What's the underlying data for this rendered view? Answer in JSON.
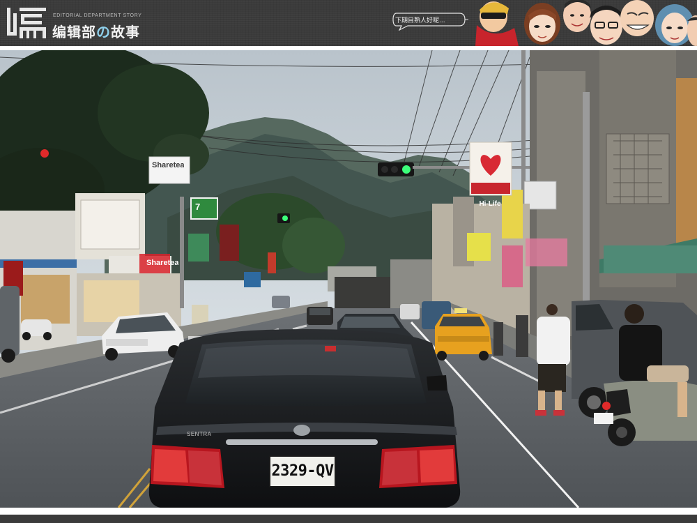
{
  "header": {
    "subtitle": "EDITORIAL DEPARTMENT STORY",
    "title_before": "编辑部",
    "title_accent": "の",
    "title_after": "故事",
    "bubble_text": "下期目熟人好呢..."
  },
  "photo": {
    "license_plate": "2329-QV",
    "car_badge": "SENTRA",
    "signs": {
      "sharetea_top": "Sharetea",
      "sharetea_shop": "Sharetea",
      "hilife": "Hi-Life",
      "seven": "7"
    }
  },
  "colors": {
    "header_bg": "#3b3b3b",
    "accent": "#8fd0ec",
    "sky": "#c9d2d8",
    "mountain": "#4b5e5a"
  }
}
